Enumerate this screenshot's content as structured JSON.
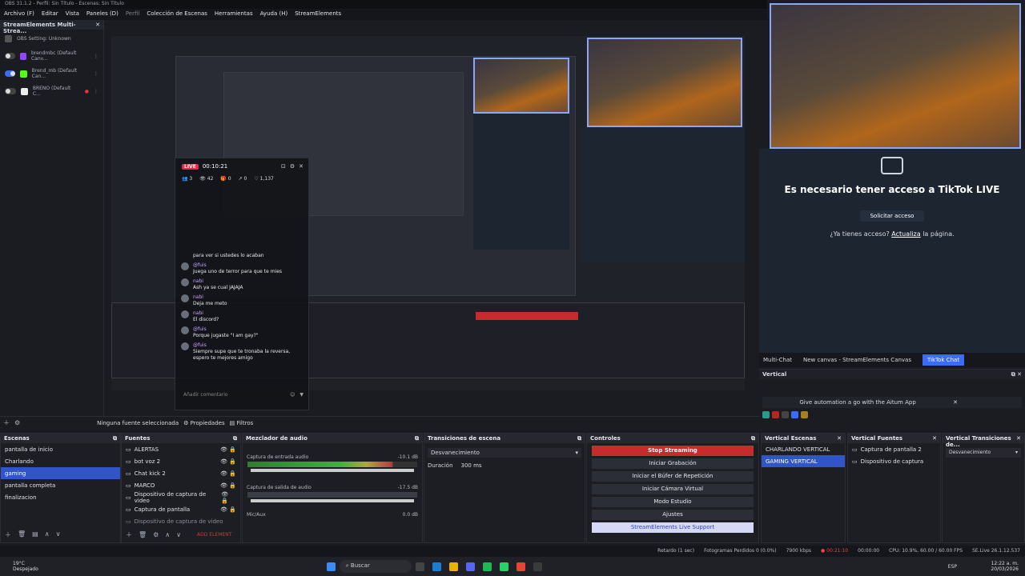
{
  "titlebar": {
    "title": "OBS 31.1.2 - Perfil: Sin Título - Escenas: Sin Título"
  },
  "menubar": {
    "items": [
      "Archivo (F)",
      "Editar",
      "Vista",
      "Paneles (D)",
      "Perfil",
      "Colección de Escenas",
      "Herramientas",
      "Ayuda (H)",
      "StreamElements"
    ]
  },
  "se_dock": {
    "title": "StreamElements Multi-Strea...",
    "rows": [
      {
        "label": "OBS Setting: Unknown"
      },
      {
        "label": "brendmbc (Default Canv..."
      },
      {
        "label": "Brend_mb (Default Can..."
      },
      {
        "label": "BRENO (Default C..."
      }
    ]
  },
  "chat": {
    "live_badge": "LIVE",
    "timer": "00:10:21",
    "stats": {
      "viewers": "3",
      "views": "42",
      "gifts": "0",
      "shares": "0",
      "likes": "1,137"
    },
    "messages": [
      {
        "user": "",
        "text": "para ver si ustedes lo acaban"
      },
      {
        "user": "@fuis",
        "text": "Juega uno de terror para que te mies"
      },
      {
        "user": "nabi",
        "text": "Ash ya se cual JAJAJA"
      },
      {
        "user": "nabi",
        "text": "Deja me meto"
      },
      {
        "user": "nabi",
        "text": "El discord?"
      },
      {
        "user": "@fuis",
        "text": "Porque jugaste \"I am gay?\""
      },
      {
        "user": "@fuis",
        "text": "Siempre supe que te tronaba la reversa, espero te mejores amigo"
      }
    ],
    "comment_placeholder": "Añadir comentario"
  },
  "tiktok": {
    "title": "Es necesario tener acceso a TikTok LIVE",
    "request_button": "Solicitar acceso",
    "note_prefix": "¿Ya tienes acceso? ",
    "note_link": "Actualiza",
    "note_suffix": " la página."
  },
  "right_tabs": [
    "Multi-Chat",
    "New canvas - StreamElements Canvas",
    "TikTok Chat"
  ],
  "vertical": {
    "title": "Vertical",
    "banner": "Give automation a go with the Aitum App"
  },
  "source_bar": {
    "no_source": "Ninguna fuente seleccionada",
    "properties": "Propiedades",
    "filters": "Filtros"
  },
  "escenas": {
    "title": "Escenas",
    "items": [
      "pantalla de inicio",
      "Charlando",
      "gaming",
      "pantalla completa",
      "finalizacion"
    ],
    "selected": 2
  },
  "fuentes": {
    "title": "Fuentes",
    "items": [
      "ALERTAS",
      "bot voz 2",
      "Chat kick 2",
      "MARCO",
      "Dispositivo de captura de video",
      "Captura de pantalla",
      "Dispositivo de captura de video"
    ],
    "add_element": "ADD ELEMENT"
  },
  "mezclador": {
    "title": "Mezclador de audio",
    "channels": [
      {
        "name": "Captura de entrada audio",
        "db": "-10.1 dB"
      },
      {
        "name": "Captura de salida de audio",
        "db": "-17.5 dB"
      },
      {
        "name": "Mic/Aux",
        "db": "0.0 dB"
      }
    ]
  },
  "transiciones": {
    "title": "Transiciones de escena",
    "transition": "Desvanecimiento",
    "duration_label": "Duración",
    "duration": "300 ms"
  },
  "controles": {
    "title": "Controles",
    "stop_streaming": "Stop Streaming",
    "start_recording": "Iniciar Grabación",
    "replay_buffer": "Iniciar el Búfer de Repetición",
    "virtual_camera": "Iniciar Cámara Virtual",
    "studio_mode": "Modo Estudio",
    "settings": "Ajustes",
    "se_support": "StreamElements Live Support"
  },
  "vertical_escenas": {
    "title": "Vertical Escenas",
    "items": [
      "CHARLANDO VERTICAL",
      "GAMING VERTICAL"
    ],
    "selected": 1
  },
  "vertical_fuentes": {
    "title": "Vertical Fuentes",
    "items": [
      "Captura de pantalla 2",
      "Dispositivo de captura"
    ]
  },
  "vertical_transiciones": {
    "title": "Vertical Transiciones de...",
    "transition": "Desvanecimiento"
  },
  "statusbar": {
    "delay": "Retardo (1 sec)",
    "dropped": "Fotogramas Perdidos 0 (0.0%)",
    "bitrate": "7900 kbps",
    "live_time": "00:21:10",
    "rec_time": "00:00:00",
    "cpu": "CPU: 10.9%, 60.00 / 60.00 FPS",
    "se_version": "SE.Live 26.1.12.537"
  },
  "taskbar": {
    "weather_temp": "19°C",
    "weather_desc": "Despejado",
    "search": "Buscar",
    "lang": "ESP",
    "time": "12:22 a. m.",
    "date": "20/03/2026"
  }
}
